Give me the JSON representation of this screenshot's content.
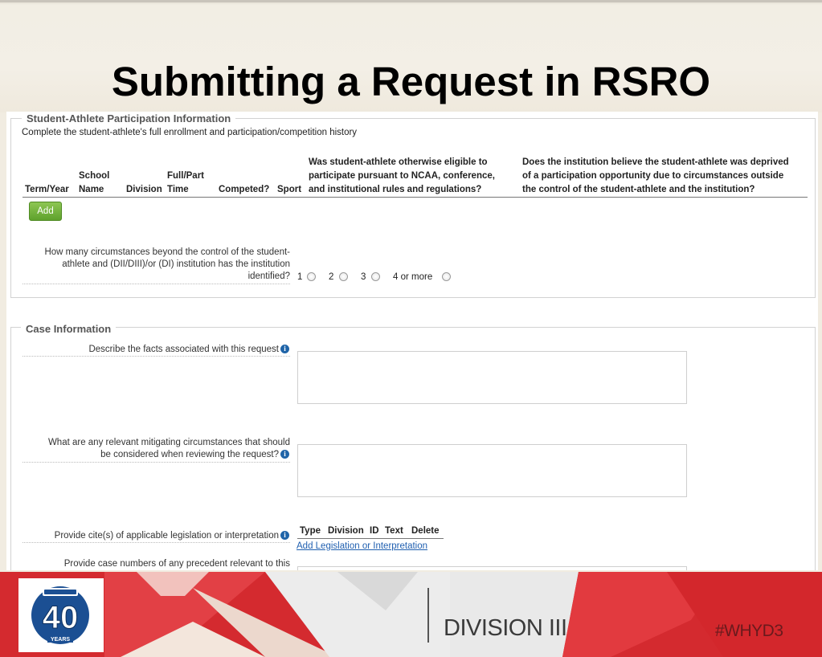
{
  "slide": {
    "title": "Submitting a Request in RSRO"
  },
  "participation": {
    "legend": "Student-Athlete Participation Information",
    "instructions": "Complete the student-athlete's full enrollment and participation/competition history",
    "columns": {
      "term": "Term/Year",
      "school_1": "School",
      "school_2": "Name",
      "division": "Division",
      "fullpart_1": "Full/Part",
      "fullpart_2": "Time",
      "competed": "Competed?",
      "sport": "Sport",
      "eligible_1": "Was student-athlete otherwise eligible to",
      "eligible_2": "participate pursuant to NCAA, conference,",
      "eligible_3": "and institutional rules and regulations?",
      "deprived_1": "Does the institution believe the student-athlete was deprived",
      "deprived_2": "of a participation opportunity due to circumstances outside",
      "deprived_3": "the control of the student-athlete and the institution?"
    },
    "add_label": "Add",
    "circumstances_question_1": "How many circumstances beyond the control of the student-",
    "circumstances_question_2": "athlete and (DII/DIII)/or (DI) institution has the institution",
    "circumstances_question_3": "identified?",
    "options": [
      "1",
      "2",
      "3",
      "4 or more"
    ]
  },
  "case": {
    "legend": "Case Information",
    "facts_label": "Describe the facts associated with this request",
    "mitigating_label_1": "What are any relevant mitigating circumstances that should",
    "mitigating_label_2": "be considered when reviewing the request?",
    "cite_label": "Provide cite(s) of applicable legislation or interpretation",
    "cite_columns": [
      "Type",
      "Division",
      "ID",
      "Text",
      "Delete"
    ],
    "add_legislation_link": "Add Legislation or Interpretation",
    "precedent_label": "Provide case numbers of any precedent relevant to this"
  },
  "footer": {
    "logo_number": "40",
    "logo_years": "YEARS",
    "logo_badge": "NCAA Division III",
    "division": "DIVISION III",
    "hashtag": "#WHYD3"
  },
  "colors": {
    "footer_red": "#d42a2f",
    "add_button_green": "#6bb134",
    "link_blue": "#1f5fb0",
    "logo_blue": "#1b4f93"
  }
}
